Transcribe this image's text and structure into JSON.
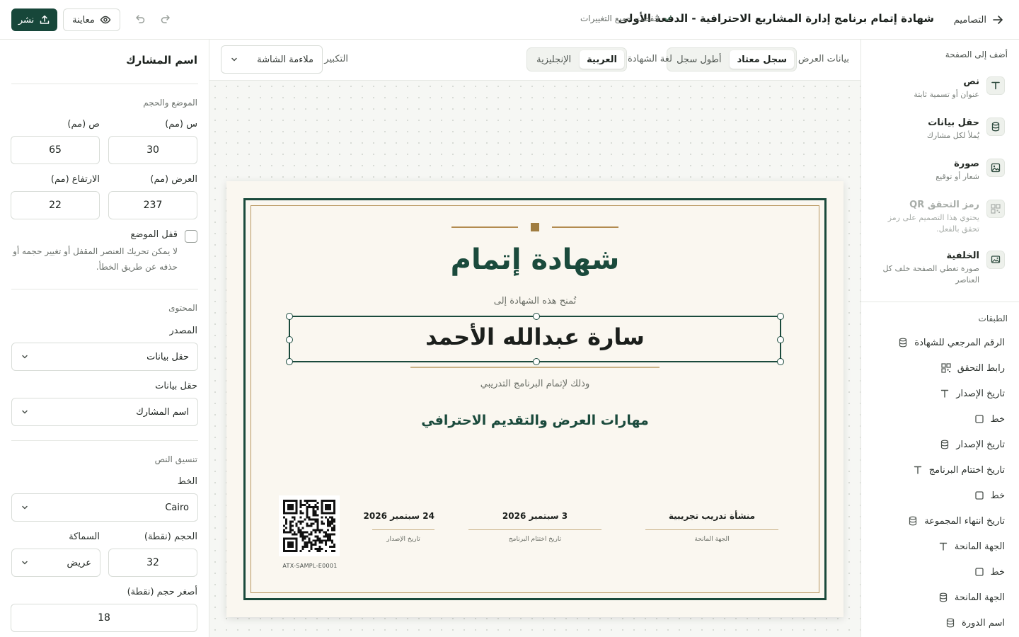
{
  "topbar": {
    "back_label": "التصاميم",
    "title": "شهادة إتمام برنامج إدارة المشاريع الاحترافية - الدفعة الأولى",
    "saved_status": "حُفظت جميع التغييرات",
    "preview_label": "معاينة",
    "publish_label": "نشر"
  },
  "add_panel": {
    "heading": "أضف إلى الصفحة",
    "items": [
      {
        "title": "نص",
        "subtitle": "عنوان أو تسمية ثابتة",
        "icon": "text-icon",
        "enabled": true
      },
      {
        "title": "حقل بيانات",
        "subtitle": "يُملأ لكل مشارك",
        "icon": "database-icon",
        "enabled": true
      },
      {
        "title": "صورة",
        "subtitle": "شعار أو توقيع",
        "icon": "image-icon",
        "enabled": true
      },
      {
        "title": "رمز التحقق QR",
        "subtitle": "يحتوي هذا التصميم على رمز تحقق بالفعل.",
        "icon": "qr-icon",
        "enabled": false
      },
      {
        "title": "الخلفية",
        "subtitle": "صورة تغطي الصفحة خلف كل العناصر",
        "icon": "background-image-icon",
        "enabled": true
      }
    ]
  },
  "layers": {
    "heading": "الطبقات",
    "items": [
      {
        "label": "الرقم المرجعي للشهادة",
        "icon": "database-icon"
      },
      {
        "label": "رابط التحقق",
        "icon": "qr-icon"
      },
      {
        "label": "تاريخ الإصدار",
        "icon": "text-icon"
      },
      {
        "label": "خط",
        "icon": "square-icon"
      },
      {
        "label": "تاريخ الإصدار",
        "icon": "database-icon"
      },
      {
        "label": "تاريخ اختتام البرنامج",
        "icon": "text-icon"
      },
      {
        "label": "خط",
        "icon": "square-icon"
      },
      {
        "label": "تاريخ انتهاء المجموعة",
        "icon": "database-icon"
      },
      {
        "label": "الجهة المانحة",
        "icon": "text-icon"
      },
      {
        "label": "خط",
        "icon": "square-icon"
      },
      {
        "label": "الجهة المانحة",
        "icon": "database-icon"
      },
      {
        "label": "اسم الدورة",
        "icon": "database-icon"
      }
    ]
  },
  "toolbar": {
    "display_data_label": "بيانات العرض",
    "record_options": [
      "سجل معتاد",
      "أطول سجل"
    ],
    "record_active": 0,
    "language_label": "لغة الشهادة",
    "language_options": [
      "العربية",
      "الإنجليزية"
    ],
    "language_active": 0,
    "zoom_label": "التكبير",
    "zoom_value": "ملاءمة الشاشة"
  },
  "certificate": {
    "title": "شهادة إتمام",
    "presented_to": "تُمنح هذه الشهادة إلى",
    "participant_name": "سارة عبدالله الأحمد",
    "completion_text": "وذلك لإتمام البرنامج التدريبي",
    "course_name": "مهارات العرض والتقديم الاحترافي",
    "issuer_value": "منشأة تدريب تجريبية",
    "issuer_label": "الجهة المانحة",
    "end_date_value": "3 سبتمبر 2026",
    "end_date_label": "تاريخ اختتام البرنامج",
    "issue_date_value": "24 سبتمبر 2026",
    "issue_date_label": "تاريخ الإصدار",
    "reference_code": "ATX-SAMPL-E0001",
    "colors": {
      "primary": "#1a4a3c",
      "gold": "#b28b4f",
      "paper": "#faf7f0"
    }
  },
  "properties": {
    "title": "اسم المشارك",
    "position_section": "الموضع والحجم",
    "x_label": "س (مم)",
    "x_value": "30",
    "y_label": "ص (مم)",
    "y_value": "65",
    "width_label": "العرض (مم)",
    "width_value": "237",
    "height_label": "الارتفاع (مم)",
    "height_value": "22",
    "lock_label": "قفل الموضع",
    "lock_checked": false,
    "lock_help": "لا يمكن تحريك العنصر المقفل أو تغيير حجمه أو حذفه عن طريق الخطأ.",
    "content_section": "المحتوى",
    "source_label": "المصدر",
    "source_value": "حقل بيانات",
    "field_label": "حقل بيانات",
    "field_value": "اسم المشارك",
    "format_section": "تنسيق النص",
    "font_label": "الخط",
    "font_value": "Cairo",
    "size_label": "الحجم (نقطة)",
    "size_value": "32",
    "weight_label": "السماكة",
    "weight_value": "عريض",
    "min_size_label": "أصغر حجم (نقطة)",
    "min_size_value": "18"
  }
}
